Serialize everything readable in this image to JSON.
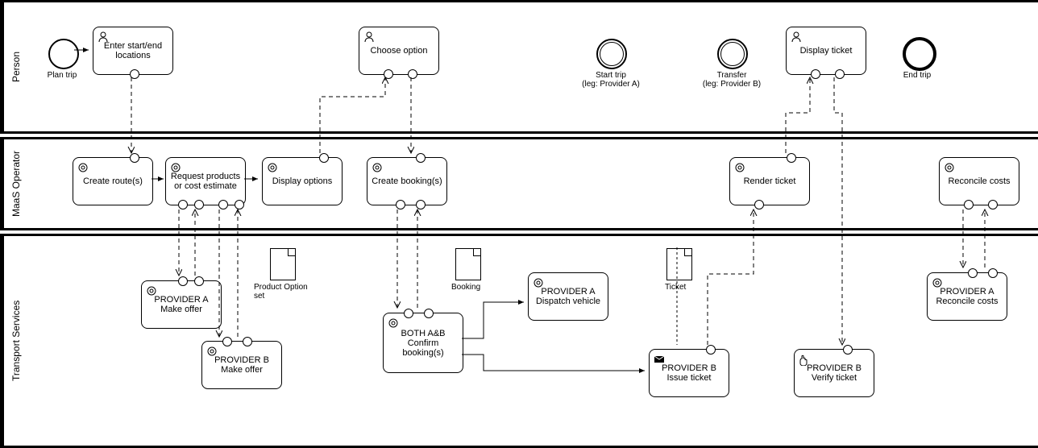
{
  "lanes": {
    "person": "Person",
    "maas": "MaaS Operator",
    "transport": "Transport Services"
  },
  "events": {
    "plan_trip": "Plan trip",
    "start_trip": "Start trip\n(leg: Provider A)",
    "transfer": "Transfer\n(leg: Provider B)",
    "end_trip": "End trip"
  },
  "tasks": {
    "enter_locations": "Enter start/end locations",
    "choose_option": "Choose option",
    "display_ticket": "Display ticket",
    "create_routes": "Create route(s)",
    "request_products": "Request products or cost estimate",
    "display_options": "Display options",
    "create_bookings": "Create booking(s)",
    "render_ticket": "Render ticket",
    "reconcile_costs": "Reconcile costs",
    "provider_a_offer": "PROVIDER A\nMake offer",
    "provider_b_offer": "PROVIDER B\nMake offer",
    "both_confirm": "BOTH A&B\nConfirm booking(s)",
    "provider_a_dispatch": "PROVIDER A\nDispatch vehicle",
    "provider_b_issue": "PROVIDER B\nIssue ticket",
    "provider_b_verify": "PROVIDER B\nVerify ticket",
    "provider_a_reconcile": "PROVIDER A\nReconcile costs"
  },
  "data_objects": {
    "product_option_set": "Product Option set",
    "booking": "Booking",
    "ticket": "Ticket"
  },
  "chart_data": {
    "type": "bpmn-diagram",
    "pools": [
      {
        "name": "Person",
        "elements": [
          "Plan trip (start event)",
          "Enter start/end locations (user task)",
          "Choose option (user task)",
          "Start trip (intermediate event, leg: Provider A)",
          "Transfer (intermediate event, leg: Provider B)",
          "Display ticket (user task)",
          "End trip (end event)"
        ]
      },
      {
        "name": "MaaS Operator",
        "elements": [
          "Create route(s) (service task)",
          "Request products or cost estimate (service task)",
          "Display options (service task)",
          "Create booking(s) (service task)",
          "Render ticket (service task)",
          "Reconcile costs (service task)"
        ]
      },
      {
        "name": "Transport Services",
        "elements": [
          "PROVIDER A Make offer (service task)",
          "PROVIDER B Make offer (service task)",
          "BOTH A&B Confirm booking(s) (service task)",
          "PROVIDER A Dispatch vehicle (service task)",
          "PROVIDER B Issue ticket (receive task)",
          "PROVIDER B Verify ticket (manual task)",
          "PROVIDER A Reconcile costs (service task)",
          "Product Option set (data object)",
          "Booking (data object)",
          "Ticket (data object)"
        ]
      }
    ],
    "sequence_flows": [
      [
        "Plan trip",
        "Enter start/end locations"
      ],
      [
        "Create route(s)",
        "Request products or cost estimate"
      ],
      [
        "Request products or cost estimate",
        "Display options"
      ],
      [
        "BOTH A&B Confirm booking(s)",
        "PROVIDER A Dispatch vehicle"
      ],
      [
        "BOTH A&B Confirm booking(s)",
        "PROVIDER B Issue ticket"
      ]
    ],
    "message_flows": [
      [
        "Enter start/end locations",
        "Create route(s)"
      ],
      [
        "Request products or cost estimate",
        "PROVIDER A Make offer"
      ],
      [
        "PROVIDER A Make offer",
        "Request products or cost estimate"
      ],
      [
        "Request products or cost estimate",
        "PROVIDER B Make offer"
      ],
      [
        "PROVIDER B Make offer",
        "Request products or cost estimate"
      ],
      [
        "Display options",
        "Choose option"
      ],
      [
        "Choose option",
        "Create booking(s)"
      ],
      [
        "Create booking(s)",
        "BOTH A&B Confirm booking(s)"
      ],
      [
        "BOTH A&B Confirm booking(s)",
        "Create booking(s)"
      ],
      [
        "PROVIDER B Issue ticket",
        "Render ticket"
      ],
      [
        "Render ticket",
        "Display ticket"
      ],
      [
        "Display ticket",
        "PROVIDER B Verify ticket"
      ],
      [
        "Reconcile costs",
        "PROVIDER A Reconcile costs"
      ],
      [
        "PROVIDER A Reconcile costs",
        "Reconcile costs"
      ]
    ]
  }
}
